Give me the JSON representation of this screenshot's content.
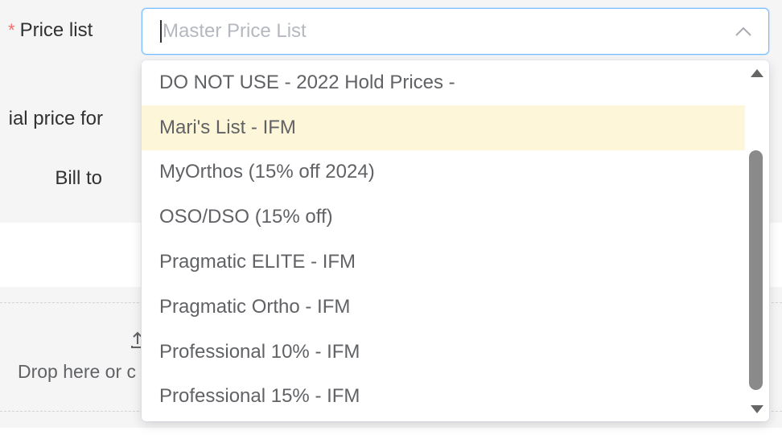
{
  "form": {
    "price_list_label": "Price list",
    "required_mark": "*",
    "special_price_label": "ial price for",
    "bill_to_label": "Bill to",
    "upload_text": "Drop here or c",
    "upload_icon": "upload-icon"
  },
  "select": {
    "placeholder": "Master Price List",
    "state": "open",
    "chevron_icon": "chevron-up-icon"
  },
  "dropdown": {
    "options": [
      "DO NOT USE - 2022 Hold Prices -",
      "Mari's List - IFM",
      "MyOrthos (15% off 2024)",
      "OSO/DSO (15% off)",
      "Pragmatic ELITE - IFM",
      "Pragmatic Ortho - IFM",
      "Professional 10% - IFM",
      "Professional 15% - IFM"
    ],
    "hovered_option": "Mari's List - IFM"
  },
  "colors": {
    "accent_border": "#79bbff",
    "required_star": "#f56c6c",
    "hover_bg": "#fdf6d8",
    "scroll_thumb": "#8a8a8a"
  }
}
